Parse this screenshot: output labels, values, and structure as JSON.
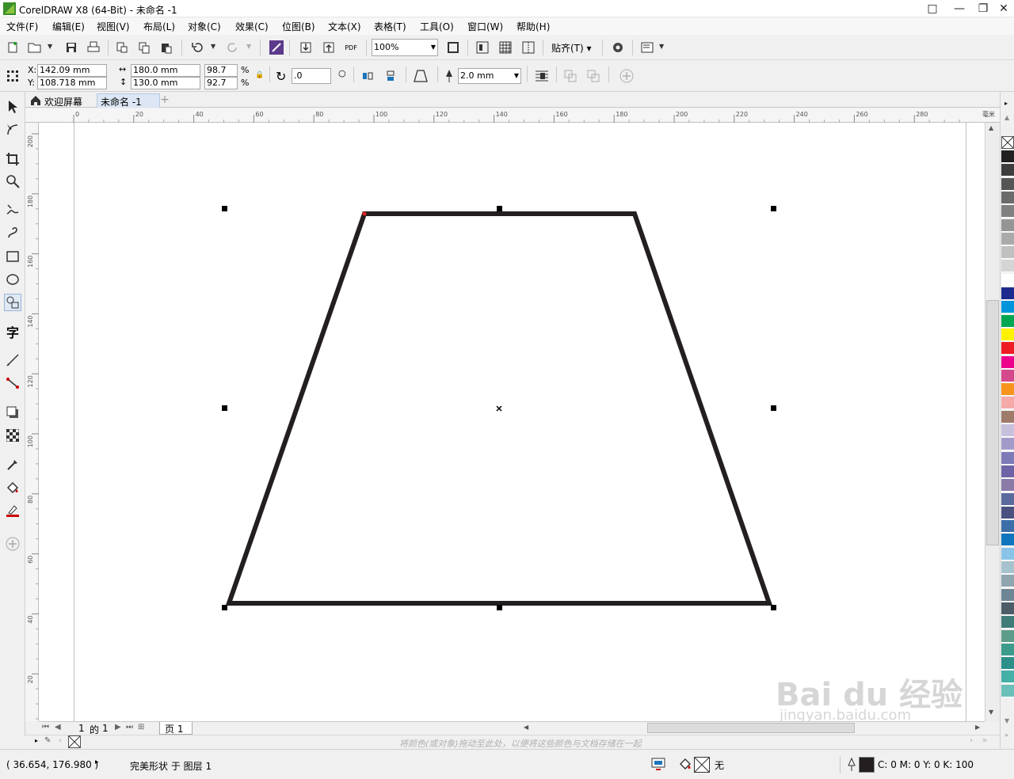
{
  "window": {
    "title": "CorelDRAW X8 (64-Bit) - 未命名 -1",
    "controls": [
      "□",
      "—",
      "❐",
      "✕"
    ]
  },
  "menu": [
    {
      "label": "文件(F)"
    },
    {
      "label": "编辑(E)"
    },
    {
      "label": "视图(V)"
    },
    {
      "label": "布局(L)"
    },
    {
      "label": "对象(C)"
    },
    {
      "label": "效果(C)"
    },
    {
      "label": "位图(B)"
    },
    {
      "label": "文本(X)"
    },
    {
      "label": "表格(T)"
    },
    {
      "label": "工具(O)"
    },
    {
      "label": "窗口(W)"
    },
    {
      "label": "帮助(H)"
    }
  ],
  "toolbar": {
    "zoom": "100%",
    "snap_label": "贴齐(T)",
    "pdf_label": "PDF"
  },
  "propbar": {
    "x_label": "X:",
    "y_label": "Y:",
    "x": "142.09 mm",
    "y": "108.718 mm",
    "width": "180.0 mm",
    "height": "130.0 mm",
    "scale_x": "98.7",
    "scale_y": "92.7",
    "percent": "%",
    "rotation": ".0",
    "outline_width": "2.0 mm"
  },
  "tabs": [
    {
      "label": "欢迎屏幕"
    },
    {
      "label": "未命名 -1"
    }
  ],
  "ruler": {
    "unit": "毫米",
    "h_ticks": [
      "0",
      "20",
      "40",
      "60",
      "80",
      "100",
      "120",
      "140",
      "160",
      "180",
      "200",
      "220",
      "240",
      "260",
      "280"
    ],
    "v_ticks": [
      "200",
      "180",
      "160",
      "140",
      "120",
      "100",
      "80",
      "60",
      "40",
      "20"
    ]
  },
  "pages": {
    "current": "1",
    "of": "的",
    "total": "1",
    "page_tab": "页 1"
  },
  "doc_palette_hint": "将颜色(或对象)拖动至此处，以便将这些颜色与文档存储在一起",
  "status": {
    "coords": "( 36.654, 176.980 )",
    "object_info": "完美形状 于 图层 1",
    "fill_none": "无",
    "outline_color": "C: 0 M: 0 Y: 0 K: 100"
  },
  "watermark": {
    "brand": "Bai du 经验",
    "url": "jingyan.baidu.com"
  },
  "palette_colors": [
    "#231f20",
    "#3d3d3d",
    "#555555",
    "#6b6b6b",
    "#808080",
    "#959595",
    "#aaaaaa",
    "#c0c0c0",
    "#d5d5d5",
    "#ffffff",
    "#1b2a8c",
    "#0095da",
    "#00a651",
    "#fff200",
    "#ed1c24",
    "#ec008c",
    "#d4498c",
    "#f7941d",
    "#f5a9a9",
    "#9e7b6b",
    "#c7c0dc",
    "#a29bc9",
    "#7d7ab8",
    "#6e63a6",
    "#8a7aa8",
    "#5a6a9e",
    "#4a5080",
    "#3c6ea8",
    "#0f75bc",
    "#89c4e8",
    "#a6c2ce",
    "#8fa5b0",
    "#6d8594",
    "#4c5d68",
    "#3f7c7a",
    "#5d9c8a",
    "#3c9b8a",
    "#2c8f8a",
    "#45b0a8",
    "#6ac0b8"
  ],
  "colors": {
    "shape_stroke": "#231f20",
    "accent": "#3a7bd5"
  }
}
